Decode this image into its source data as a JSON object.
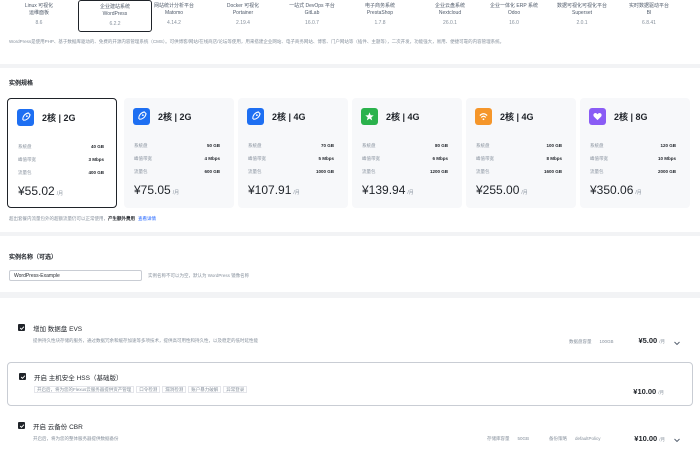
{
  "images": [
    {
      "title": "Linux 可视化",
      "title2": "运维面板",
      "version": "8.6"
    },
    {
      "title": "企业建站系统",
      "title2": "WordPress",
      "version": "6.2.2"
    },
    {
      "title": "网站统计分析平台",
      "title2": "Matomo",
      "version": "4.14.2"
    },
    {
      "title": "Docker 可视化",
      "title2": "Portainer",
      "version": "2.19.4"
    },
    {
      "title": "一站式 DevOps 平台",
      "title2": "GitLab",
      "version": "16.0.7"
    },
    {
      "title": "电子商务系统",
      "title2": "PrestaShop",
      "version": "1.7.8"
    },
    {
      "title": "企业云盘系统",
      "title2": "Nextcloud",
      "version": "26.0.1"
    },
    {
      "title": "企业一体化 ERP 系统",
      "title2": "Odoo",
      "version": "16.0"
    },
    {
      "title": "数据可视化可视化平台",
      "title2": "Superset",
      "version": "2.0.1"
    },
    {
      "title": "实时数据驱动平台",
      "title2": "BI",
      "version": "6.8.41"
    }
  ],
  "image_desc": "WordPress是使用PHP、基于数据库驱动的、免费的开源内容管理系统（CMS）。可供博客/网站/在线商店/论坛等使用，用来搭建企业网站、电子商务网站、博客、门户网站等（插件、主题等），二次开发，功能强大，易用、便捷可靠的内容管理系统。",
  "spec": {
    "title": "实例规格",
    "note_prefix": "超出套餐内流量包外的超额流量仍可以正常使用，",
    "note_bold": "产生额外费用",
    "note_link": "查看详情",
    "cards": [
      {
        "name": "2核 | 2G",
        "disk": "40 GB",
        "bw": "3 Mbps",
        "traffic": "400 GB",
        "price": "¥55.02",
        "unit": "/月",
        "color": "#1e6ff2",
        "icon": "rocket-icon",
        "selected": true
      },
      {
        "name": "2核 | 2G",
        "disk": "50 GB",
        "bw": "4 Mbps",
        "traffic": "600 GB",
        "price": "¥75.05",
        "unit": "/月",
        "color": "#1e6ff2",
        "icon": "rocket-icon",
        "selected": false
      },
      {
        "name": "2核 | 4G",
        "disk": "70 GB",
        "bw": "5 Mbps",
        "traffic": "1000 GB",
        "price": "¥107.91",
        "unit": "/月",
        "color": "#1e6ff2",
        "icon": "rocket-icon",
        "selected": false
      },
      {
        "name": "2核 | 4G",
        "disk": "80 GB",
        "bw": "6 Mbps",
        "traffic": "1200 GB",
        "price": "¥139.94",
        "unit": "/月",
        "color": "#2bb24c",
        "icon": "star-icon",
        "selected": false
      },
      {
        "name": "2核 | 4G",
        "disk": "100 GB",
        "bw": "8 Mbps",
        "traffic": "1600 GB",
        "price": "¥255.00",
        "unit": "/月",
        "color": "#f5962a",
        "icon": "signal-icon",
        "selected": false
      },
      {
        "name": "2核 | 8G",
        "disk": "120 GB",
        "bw": "10 Mbps",
        "traffic": "2000 GB",
        "price": "¥350.06",
        "unit": "/月",
        "color": "#8a5cf5",
        "icon": "heart-icon",
        "selected": false
      }
    ],
    "labels": {
      "disk": "系统盘",
      "bw": "峰值带宽",
      "traffic": "流量包"
    }
  },
  "instance_name": {
    "title": "实例名称（可选）",
    "value": "WordPress-Example",
    "hint": "实例名称不可以为空，默认为 WordPress 镜像名称"
  },
  "addons": [
    {
      "title": "增加 数据盘 EVS",
      "desc": "提供持久性块存储的服务，通过数据冗余和缓存加速等多项技术，提供高可用性和持久性，以及稳定的低时延性能",
      "meta_label": "数据盘容量",
      "meta_value": "100GB",
      "price": "¥5.00",
      "unit": "/月"
    },
    {
      "title": "开启 主机安全 HSS（基础版）",
      "tags": [
        "开启后，将为您的Flexus云服务器提供资产管理",
        "口令检测",
        "漏洞检测",
        "账户暴力破解",
        "异常登录"
      ],
      "price": "¥10.00",
      "unit": "/月"
    },
    {
      "title": "开启 云备份 CBR",
      "desc": "开启后，将为您的整体服务器提供数据备份",
      "meta1_label": "存储库容量",
      "meta1_value": "50GB",
      "meta2_label": "备份策略",
      "meta2_value": "defaultPolicy",
      "price": "¥10.00",
      "unit": "/月"
    }
  ]
}
